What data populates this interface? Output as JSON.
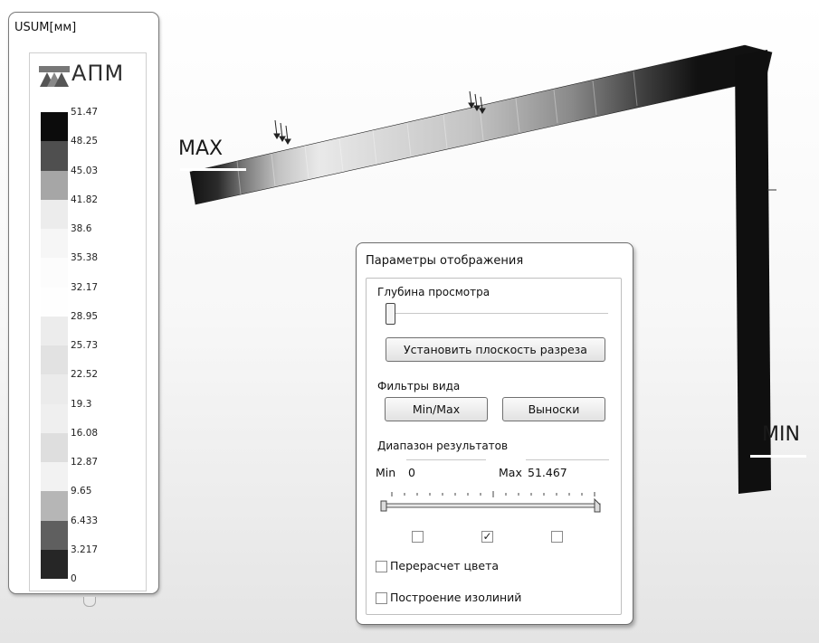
{
  "legend": {
    "title": "USUM[мм]",
    "logo_text": "АПМ",
    "scale_labels": [
      "51.47",
      "48.25",
      "45.03",
      "41.82",
      "38.6",
      "35.38",
      "32.17",
      "28.95",
      "25.73",
      "22.52",
      "19.3",
      "16.08",
      "12.87",
      "9.65",
      "6.433",
      "3.217",
      "0"
    ],
    "scale_colors": [
      "#0c0c0c",
      "#4f4f4f",
      "#a6a6a6",
      "#ececec",
      "#f6f6f6",
      "#fcfcfc",
      "#fefefe",
      "#ececec",
      "#e2e2e2",
      "#ebebeb",
      "#efefef",
      "#dedede",
      "#f2f2f2",
      "#b6b6b6",
      "#5f5f5f",
      "#262626"
    ]
  },
  "scene": {
    "max_label": "MAX",
    "min_label": "MIN"
  },
  "dialog": {
    "title": "Параметры отображения",
    "depth_label": "Глубина просмотра",
    "section_plane_button": "Установить плоскость разреза",
    "view_filters_label": "Фильтры вида",
    "minmax_button": "Min/Max",
    "callouts_button": "Выноски",
    "range_label": "Диапазон результатов",
    "min_label": "Min",
    "min_value": "0",
    "max_label": "Max",
    "max_value": "51.467",
    "range_checkboxes": [
      false,
      true,
      false
    ],
    "color_recalc_label": "Перерасчет цвета",
    "color_recalc_checked": false,
    "isolines_label": "Построение изолиний",
    "isolines_checked": false
  }
}
